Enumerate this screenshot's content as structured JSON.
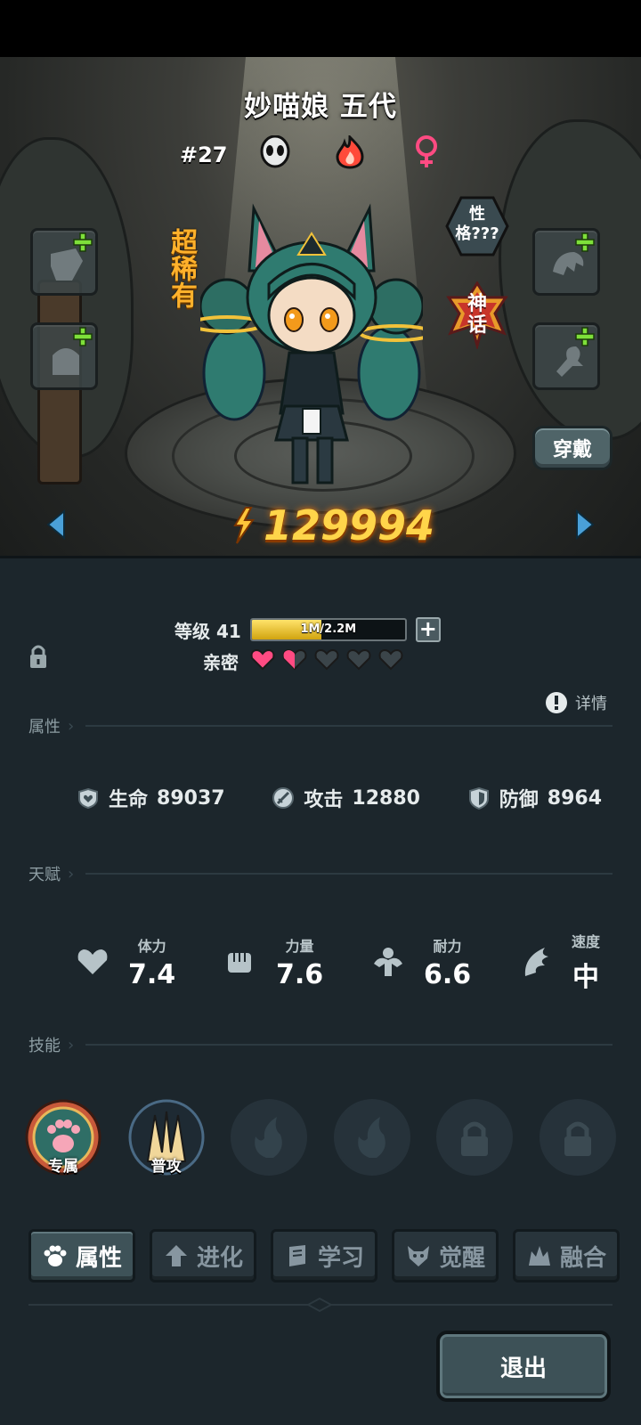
{
  "hero": {
    "name": "妙喵娘 五代",
    "number": "#27",
    "rarity": "超稀有",
    "personality": "性格???",
    "tier_badge": "神话",
    "wear_button": "穿戴",
    "power": "129994"
  },
  "progress": {
    "level_label": "等级 41",
    "xp_text": "1M/2.2M",
    "xp_fraction": 0.455,
    "intimacy_label": "亲密",
    "intimacy_hearts": [
      1,
      0.5,
      0,
      0,
      0
    ]
  },
  "sections": {
    "attributes": "属性",
    "talents": "天赋",
    "skills": "技能",
    "detail": "详情"
  },
  "stats": [
    {
      "label": "生命",
      "value": "89037",
      "icon": "heart-shield-icon"
    },
    {
      "label": "攻击",
      "value": "12880",
      "icon": "sword-icon"
    },
    {
      "label": "防御",
      "value": "8964",
      "icon": "shield-icon"
    }
  ],
  "talents": [
    {
      "label": "体力",
      "value": "7.4",
      "icon": "heart-icon"
    },
    {
      "label": "力量",
      "value": "7.6",
      "icon": "fist-icon"
    },
    {
      "label": "耐力",
      "value": "6.6",
      "icon": "muscle-icon"
    },
    {
      "label": "速度",
      "value": "中",
      "icon": "wing-icon"
    }
  ],
  "skills": [
    {
      "tag": "专属",
      "icon": "paw-skill-icon"
    },
    {
      "tag": "普攻",
      "icon": "claw-skill-icon"
    },
    {
      "tag": "",
      "icon": "flame-slot-icon"
    },
    {
      "tag": "",
      "icon": "flame-slot-icon"
    },
    {
      "tag": "",
      "icon": "lock-icon"
    },
    {
      "tag": "",
      "icon": "lock-icon"
    }
  ],
  "tabs": [
    "属性",
    "进化",
    "学习",
    "觉醒",
    "融合"
  ],
  "exit": "退出",
  "colors": {
    "panel_bg": "#1c262c",
    "power_gold": "#ffd54a",
    "rarity_orange": "#ffb12b",
    "heart_pink": "#ff4b82"
  }
}
